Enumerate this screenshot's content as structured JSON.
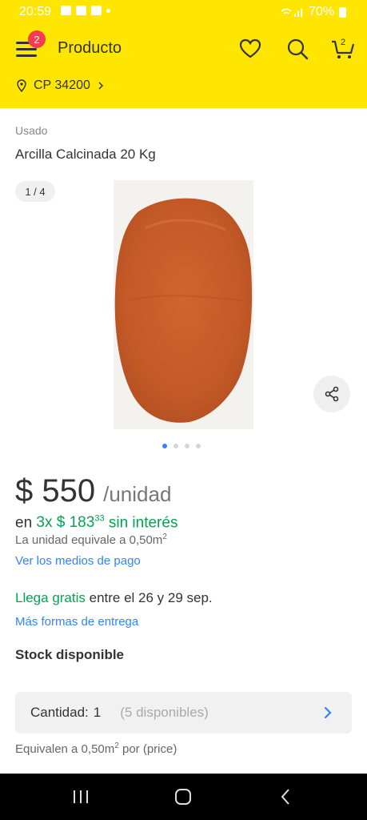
{
  "status_bar": {
    "time": "20:59",
    "battery": "70%"
  },
  "header": {
    "title": "Producto",
    "menu_badge": "2",
    "cart_count": "2",
    "location": "CP 34200"
  },
  "product": {
    "condition": "Usado",
    "title": "Arcilla Calcinada 20 Kg",
    "gallery_counter": "1 / 4",
    "gallery_total": 4,
    "gallery_current": 1,
    "price": "$ 550",
    "price_unit": "/unidad",
    "installments_prefix": "en",
    "installments_green": "3x $ 183",
    "installments_cents": "33",
    "installments_suffix": "sin interés",
    "unit_equivalence": "La unidad equivale a 0,50m",
    "unit_equivalence_sup": "2",
    "payment_methods_link": "Ver los medios de pago",
    "shipping_green": "Llega gratis",
    "shipping_text": " entre el 26 y 29 sep.",
    "more_shipping_link": "Más formas de entrega",
    "stock": "Stock disponible",
    "quantity_label": "Cantidad:",
    "quantity_value": "1",
    "quantity_available": "(5 disponibles)",
    "footer_equiv": "Equivalen a 0,50m",
    "footer_equiv_sup": "2",
    "footer_equiv_suffix": " por (price)"
  },
  "colors": {
    "brand_yellow": "#ffe600",
    "link_blue": "#3483fa",
    "green": "#00a650",
    "badge_red": "#f23d4f"
  }
}
